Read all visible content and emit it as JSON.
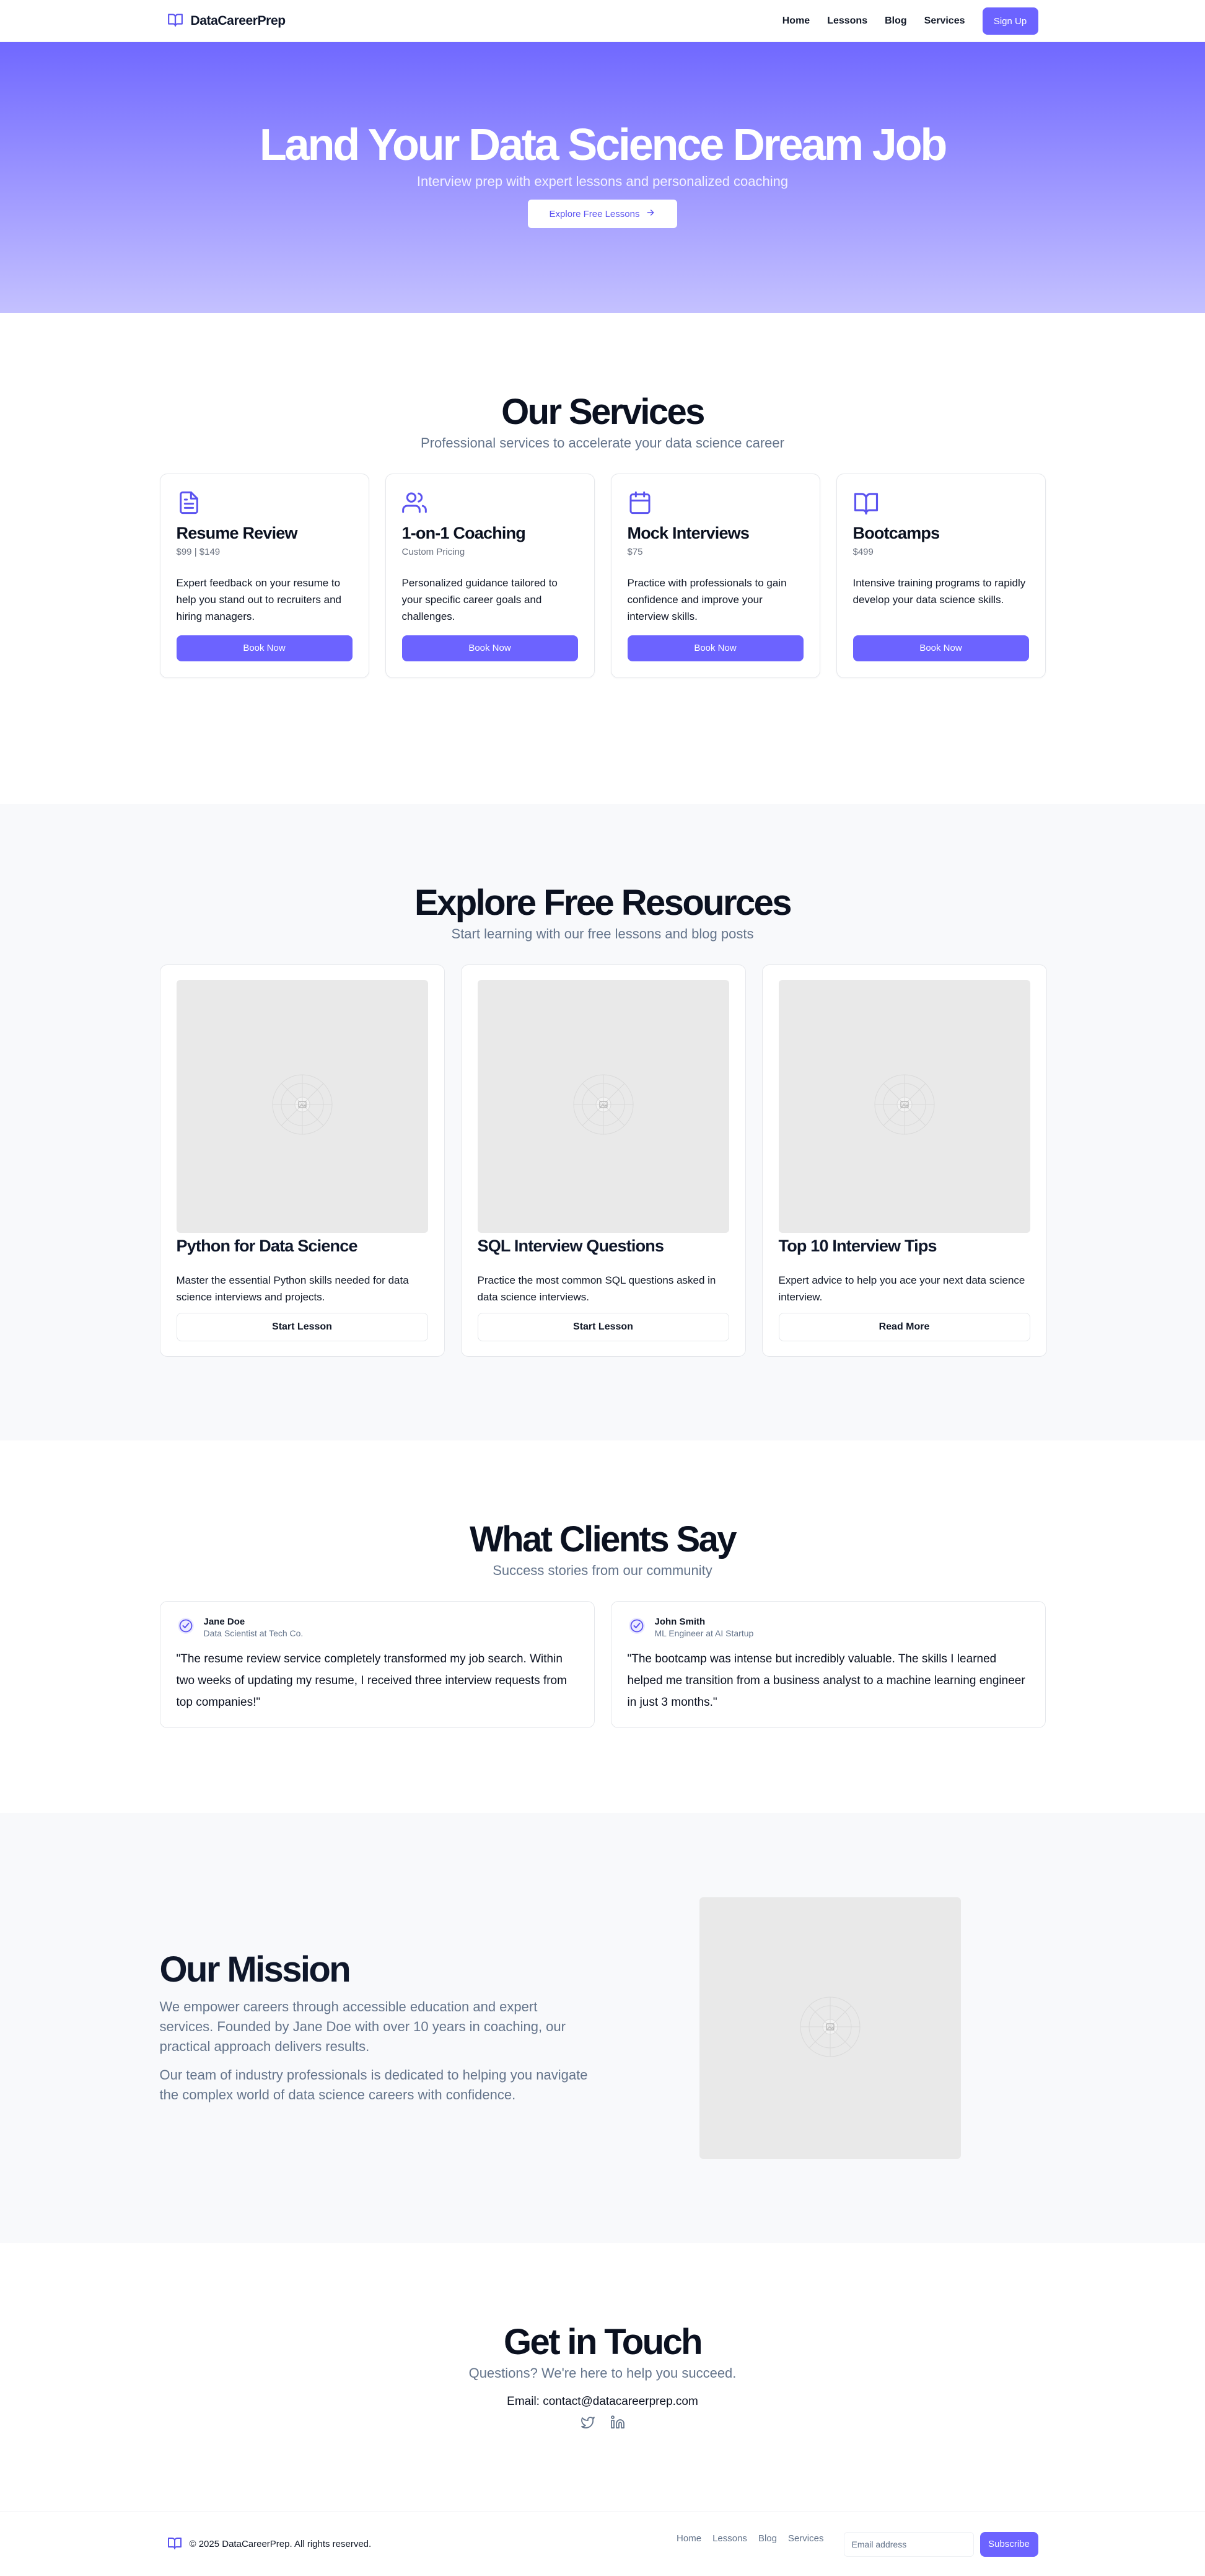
{
  "colors": {
    "accent": "#6c63ff",
    "hero_top": "#7068ff",
    "hero_bottom": "#c4c1ff",
    "muted": "#64748b"
  },
  "header": {
    "logo": "DataCareerPrep",
    "nav": [
      "Home",
      "Lessons",
      "Blog",
      "Services"
    ],
    "signup": "Sign Up"
  },
  "hero": {
    "title": "Land Your Data Science Dream Job",
    "subtitle": "Interview prep with expert lessons and personalized coaching",
    "cta": "Explore Free Lessons"
  },
  "services": {
    "title": "Our Services",
    "subtitle": "Professional services to accelerate your data science career",
    "items": [
      {
        "icon": "file-text-icon",
        "title": "Resume Review",
        "price": "$99 | $149",
        "desc": "Expert feedback on your resume to help you stand out to recruiters and hiring managers.",
        "button": "Book Now"
      },
      {
        "icon": "users-icon",
        "title": "1-on-1 Coaching",
        "price": "Custom Pricing",
        "desc": "Personalized guidance tailored to your specific career goals and challenges.",
        "button": "Book Now"
      },
      {
        "icon": "calendar-icon",
        "title": "Mock Interviews",
        "price": "$75",
        "desc": "Practice with professionals to gain confidence and improve your interview skills.",
        "button": "Book Now"
      },
      {
        "icon": "book-open-icon",
        "title": "Bootcamps",
        "price": "$499",
        "desc": "Intensive training programs to rapidly develop your data science skills.",
        "button": "Book Now"
      }
    ]
  },
  "resources": {
    "title": "Explore Free Resources",
    "subtitle": "Start learning with our free lessons and blog posts",
    "items": [
      {
        "title": "Python for Data Science",
        "desc": "Master the essential Python skills needed for data science interviews and projects.",
        "button": "Start Lesson"
      },
      {
        "title": "SQL Interview Questions",
        "desc": "Practice the most common SQL questions asked in data science interviews.",
        "button": "Start Lesson"
      },
      {
        "title": "Top 10 Interview Tips",
        "desc": "Expert advice to help you ace your next data science interview.",
        "button": "Read More"
      }
    ]
  },
  "testimonials": {
    "title": "What Clients Say",
    "subtitle": "Success stories from our community",
    "items": [
      {
        "name": "Jane Doe",
        "role": "Data Scientist at Tech Co.",
        "quote": "\"The resume review service completely transformed my job search. Within two weeks of updating my resume, I received three interview requests from top companies!\""
      },
      {
        "name": "John Smith",
        "role": "ML Engineer at AI Startup",
        "quote": "\"The bootcamp was intense but incredibly valuable. The skills I learned helped me transition from a business analyst to a machine learning engineer in just 3 months.\""
      }
    ]
  },
  "mission": {
    "title": "Our Mission",
    "p1": "We empower careers through accessible education and expert services. Founded by Jane Doe with over 10 years in coaching, our practical approach delivers results.",
    "p2": "Our team of industry professionals is dedicated to helping you navigate the complex world of data science careers with confidence."
  },
  "contact": {
    "title": "Get in Touch",
    "subtitle": "Questions? We're here to help you succeed.",
    "email": "Email: contact@datacareerprep.com",
    "socials": [
      "twitter-icon",
      "linkedin-icon"
    ]
  },
  "footer": {
    "copyright": "© 2025 DataCareerPrep. All rights reserved.",
    "nav": [
      "Home",
      "Lessons",
      "Blog",
      "Services"
    ],
    "email_placeholder": "Email address",
    "subscribe": "Subscribe"
  }
}
